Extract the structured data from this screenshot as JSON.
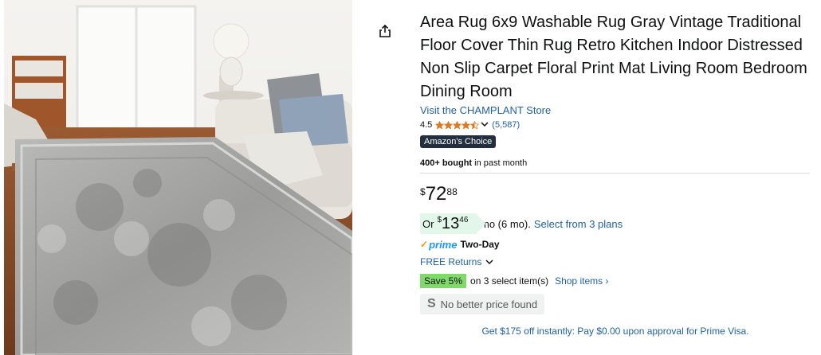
{
  "product": {
    "title": "Area Rug 6x9 Washable Rug Gray Vintage Traditional Floor Cover Thin Rug Retro Kitchen Indoor Distressed Non Slip Carpet Floral Print Mat Living Room Bedroom Dining Room",
    "store_link": "Visit the CHAMPLANT Store",
    "rating": "4.5",
    "rating_stars": 4.5,
    "review_count": "(5,587)",
    "badge": "Amazon's Choice",
    "bought_bold": "400+ bought",
    "bought_rest": " in past month"
  },
  "price": {
    "symbol": "$",
    "whole": "72",
    "fraction": "88"
  },
  "monthly": {
    "prefix": "Or",
    "symbol": "$",
    "whole": "13",
    "fraction": "46",
    "suffix": "/mo (6 mo).",
    "plans_link": "Select from 3 plans"
  },
  "delivery": {
    "prime_label": "prime",
    "prime_speed": "Two-Day",
    "returns": "FREE Returns"
  },
  "promo": {
    "save_pill": "Save 5%",
    "save_text": "on 3 select item(s)",
    "shop_link": "Shop items ›"
  },
  "nbp": {
    "icon_letter": "S",
    "label": "No better price found"
  },
  "visa_offer": "Get $175 off instantly: Pay $0.00 upon approval for Prime Visa.",
  "colors": {
    "link": "#2162a1",
    "badge_bg": "#232f3e",
    "star": "#de7921",
    "save_green": "#7fda69",
    "monthly_bg": "#e3f6ea",
    "prime_blue": "#1a98ff",
    "prime_check": "#ff9900"
  }
}
